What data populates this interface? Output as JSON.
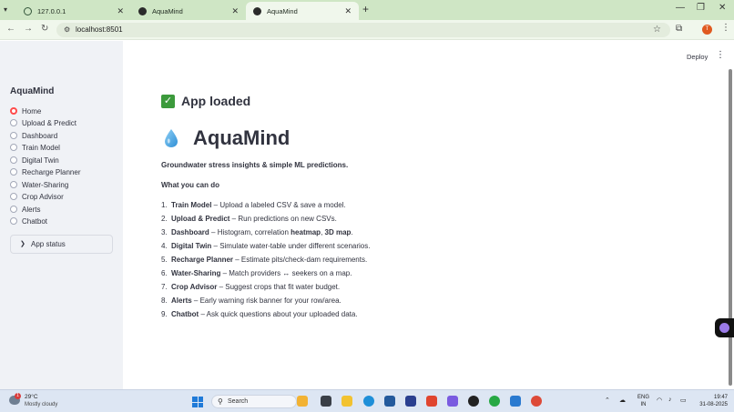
{
  "browser": {
    "tabs": [
      {
        "label": "127.0.0.1",
        "active": false
      },
      {
        "label": "AquaMind",
        "active": false
      },
      {
        "label": "AquaMind",
        "active": true
      }
    ],
    "url": "localhost:8501"
  },
  "header": {
    "deploy_label": "Deploy"
  },
  "sidebar": {
    "title": "AquaMind",
    "nav": [
      {
        "label": "Home",
        "selected": true
      },
      {
        "label": "Upload & Predict",
        "selected": false
      },
      {
        "label": "Dashboard",
        "selected": false
      },
      {
        "label": "Train Model",
        "selected": false
      },
      {
        "label": "Digital Twin",
        "selected": false
      },
      {
        "label": "Recharge Planner",
        "selected": false
      },
      {
        "label": "Water-Sharing",
        "selected": false
      },
      {
        "label": "Crop Advisor",
        "selected": false
      },
      {
        "label": "Alerts",
        "selected": false
      },
      {
        "label": "Chatbot",
        "selected": false
      }
    ],
    "status_label": "App status"
  },
  "main": {
    "loaded_text": "App loaded",
    "title": "AquaMind",
    "subtitle": "Groundwater stress insights & simple ML predictions.",
    "section_heading": "What you can do",
    "features": [
      {
        "num": "1.",
        "name": "Train Model",
        "desc": " – Upload a labeled CSV & save a model."
      },
      {
        "num": "2.",
        "name": "Upload & Predict",
        "desc": " – Run predictions on new CSVs."
      },
      {
        "num": "3.",
        "name": "Dashboard",
        "desc": " – Histogram, correlation ",
        "bold2": "heatmap",
        "desc2": ", ",
        "bold3": "3D map",
        "desc3": "."
      },
      {
        "num": "4.",
        "name": "Digital Twin",
        "desc": " – Simulate water-table under different scenarios."
      },
      {
        "num": "5.",
        "name": "Recharge Planner",
        "desc": " – Estimate pits/check-dam requirements."
      },
      {
        "num": "6.",
        "name": "Water-Sharing",
        "desc": " – Match providers ↔ seekers on a map."
      },
      {
        "num": "7.",
        "name": "Crop Advisor",
        "desc": " – Suggest crops that fit water budget."
      },
      {
        "num": "8.",
        "name": "Alerts",
        "desc": " – Early warning risk banner for your row/area."
      },
      {
        "num": "9.",
        "name": "Chatbot",
        "desc": " – Ask quick questions about your uploaded data."
      }
    ]
  },
  "taskbar": {
    "weather_temp": "29°C",
    "weather_desc": "Mostly cloudy",
    "weather_badge": "1",
    "search_label": "Search",
    "lang_line1": "ENG",
    "lang_line2": "IN",
    "time": "19:47",
    "date": "31-08-2025"
  },
  "colors": {
    "accent": "#ff4b4b",
    "sidebar_bg": "#f0f2f6",
    "text": "#31333f",
    "tabstrip": "#cfe6c5"
  }
}
